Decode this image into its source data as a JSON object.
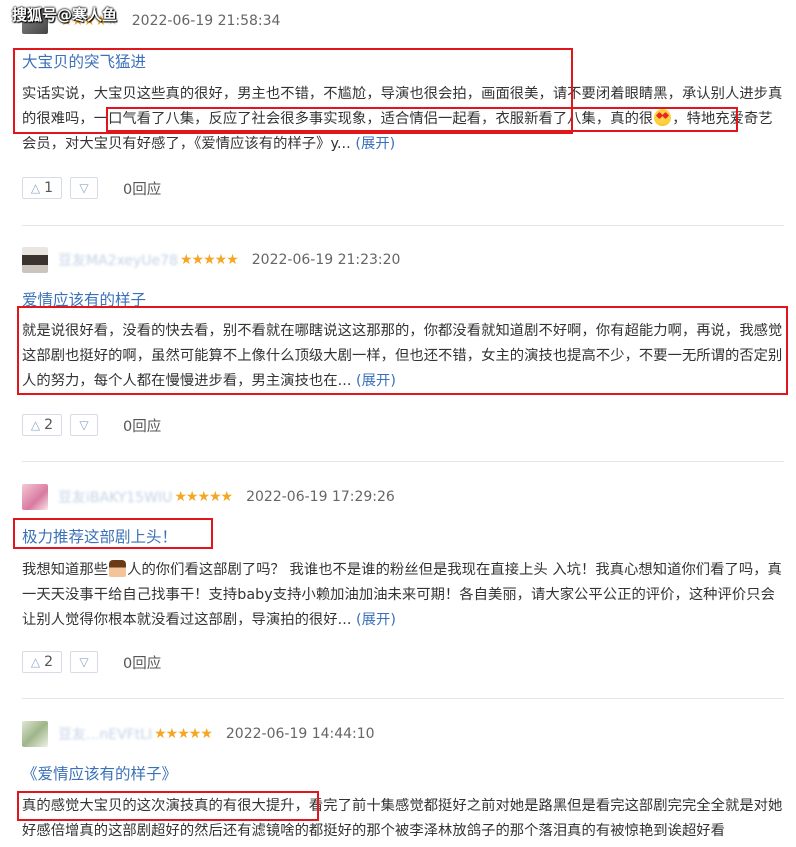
{
  "watermark": "搜狐号@寒人鱼",
  "reviews": [
    {
      "username": "",
      "stars": "★★★★",
      "stars_off": "★",
      "rating": 4,
      "date": "2022-06-19 21:58:34",
      "title": "大宝贝的突飞猛进",
      "body": "实话实说，大宝贝这些真的很好，男主也不错，不尴尬，导演也很会拍，画面很美，请不要闭着眼睛黑，承认别人进步真的很难吗，一口气看了八集，反应了社会很多事实现象，适合情侣一起看，衣服新看了八集，真的很",
      "body_after": "，特地充爱奇艺会员，对大宝贝有好感了，《爱情应该有的样子》y... ",
      "expand": "(展开)",
      "up": "1",
      "reply": "0回应"
    },
    {
      "username": "豆友MA2xeyUe78",
      "stars": "★★★★★",
      "rating": 5,
      "date": "2022-06-19 21:23:20",
      "title": "爱情应该有的样子",
      "body": "就是说很好看，没看的快去看，别不看就在哪瞎说这这那那的，你都没看就知道剧不好啊，你有超能力啊，再说，我感觉这部剧也挺好的啊，虽然可能算不上像什么顶级大剧一样，但也还不错，女主的演技也提高不少，不要一无所谓的否定别人的努力，每个人都在慢慢进步看，男主演技也在... ",
      "expand": "(展开)",
      "up": "2",
      "reply": "0回应"
    },
    {
      "username": "豆友iBAKY15WIU",
      "stars": "★★★★★",
      "rating": 5,
      "date": "2022-06-19 17:29:26",
      "title": "极力推荐这部剧上头！",
      "body_before": "我想知道那些",
      "body": "人的你们看这部剧了吗？ 我谁也不是谁的粉丝但是我现在直接上头 入坑！我真心想知道你们看了吗，真一天天没事干给自己找事干！支持baby支持小赖加油加油未来可期！各自美丽，请大家公平公正的评价，这种评价只会让别人觉得你根本就没看过这部剧，导演拍的很好... ",
      "expand": "(展开)",
      "up": "2",
      "reply": "0回应"
    },
    {
      "username": "豆友...nEVFtLI",
      "stars": "★★★★★",
      "rating": 5,
      "date": "2022-06-19 14:44:10",
      "title": "《爱情应该有的样子》",
      "body": "真的感觉大宝贝的这次演技真的有很大提升，看完了前十集感觉都挺好之前对她是路黑但是看完这部剧完完全全就是对她好感倍增真的这部剧超好的然后还有滤镜啥的都挺好的那个被李泽林放鸽子的那个落泪真的有被惊艳到诶超好看"
    }
  ],
  "colors": {
    "link": "#3b71b8",
    "star": "#f5a623",
    "highlight": "#e0161a"
  }
}
